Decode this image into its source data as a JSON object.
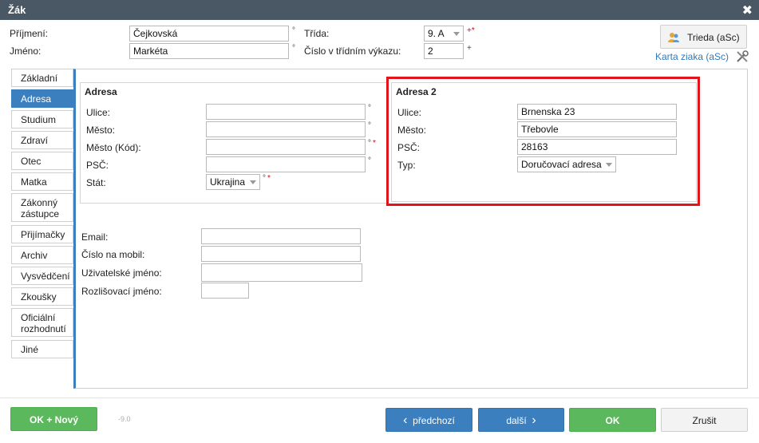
{
  "window": {
    "title": "Žák"
  },
  "header": {
    "surname_label": "Příjmení:",
    "surname_value": "Čejkovská",
    "firstname_label": "Jméno:",
    "firstname_value": "Markéta",
    "class_label": "Třída:",
    "class_value": "9. A",
    "class_marks": "+*",
    "report_no_label": "Číslo v třídním výkazu:",
    "report_no_value": "2",
    "report_no_mark": "+",
    "trieda_button": "Trieda (aSc)",
    "karta_link": "Karta ziaka (aSc)"
  },
  "tabs": [
    {
      "label": "Základní"
    },
    {
      "label": "Adresa",
      "active": true
    },
    {
      "label": "Studium"
    },
    {
      "label": "Zdraví"
    },
    {
      "label": "Otec"
    },
    {
      "label": "Matka"
    },
    {
      "label": "Zákonný zástupce"
    },
    {
      "label": "Přijímačky"
    },
    {
      "label": "Archiv"
    },
    {
      "label": "Vysvědčení"
    },
    {
      "label": "Zkoušky"
    },
    {
      "label": "Oficiální rozhodnutí"
    },
    {
      "label": "Jiné"
    }
  ],
  "address1": {
    "title": "Adresa",
    "street_label": "Ulice:",
    "street_value": "",
    "city_label": "Město:",
    "city_value": "",
    "city_code_label": "Město (Kód):",
    "city_code_value": "",
    "zip_label": "PSČ:",
    "zip_value": "",
    "country_label": "Stát:",
    "country_value": "Ukrajina"
  },
  "address2": {
    "title": "Adresa 2",
    "street_label": "Ulice:",
    "street_value": "Brnenska 23",
    "city_label": "Město:",
    "city_value": "Třebovle",
    "zip_label": "PSČ:",
    "zip_value": "28163",
    "type_label": "Typ:",
    "type_value": "Doručovací adresa"
  },
  "contact": {
    "email_label": "Email:",
    "email_value": "",
    "mobile_label": "Číslo na mobil:",
    "mobile_value": "",
    "username_label": "Uživatelské jméno:",
    "username_value": "",
    "distinct_label": "Rozlišovací jméno:",
    "distinct_value": ""
  },
  "footer": {
    "ok_new": "OK + Nový",
    "version": "-9.0",
    "prev": "předchozí",
    "next": "další",
    "ok": "OK",
    "cancel": "Zrušit"
  },
  "marks": {
    "circle": "°",
    "required": "*"
  },
  "colors": {
    "titlebar": "#4a5866",
    "accent": "#3c7fbf",
    "ok_green": "#5cb85c",
    "highlight": "#e2141c"
  }
}
